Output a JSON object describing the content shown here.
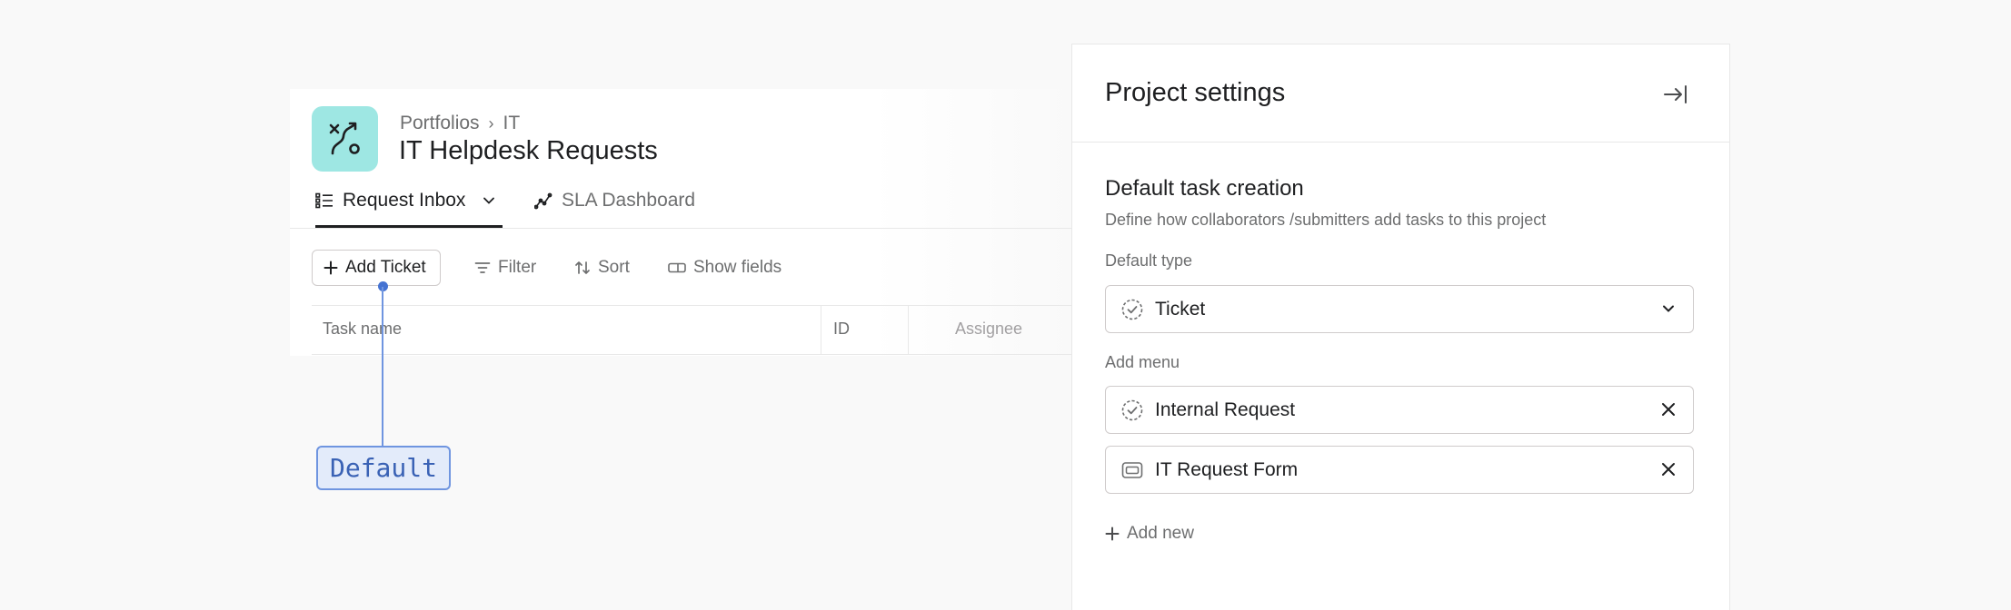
{
  "project": {
    "breadcrumb": [
      "Portfolios",
      "IT"
    ],
    "breadcrumb_separator": "›",
    "title": "IT Helpdesk Requests",
    "icon_color": "#9ee7e3"
  },
  "tabs": [
    {
      "label": "Request Inbox",
      "icon": "list-icon",
      "active": true
    },
    {
      "label": "SLA Dashboard",
      "icon": "line-chart-icon",
      "active": false
    }
  ],
  "toolbar": {
    "add_ticket": "Add Ticket",
    "filter": "Filter",
    "sort": "Sort",
    "show_fields": "Show fields"
  },
  "table": {
    "columns": [
      "Task name",
      "ID",
      "Assignee"
    ]
  },
  "annotation": {
    "label": "Default",
    "color": "#4573d2"
  },
  "panel": {
    "title": "Project settings",
    "section_title": "Default task creation",
    "section_subtitle": "Define how collaborators /submitters add tasks to this project",
    "default_type_label": "Default type",
    "default_type_value": "Ticket",
    "add_menu_label": "Add menu",
    "add_menu_items": [
      {
        "label": "Internal Request",
        "icon": "check-circle-dashed-icon"
      },
      {
        "label": "IT Request Form",
        "icon": "form-icon"
      }
    ],
    "add_new": "Add new"
  }
}
